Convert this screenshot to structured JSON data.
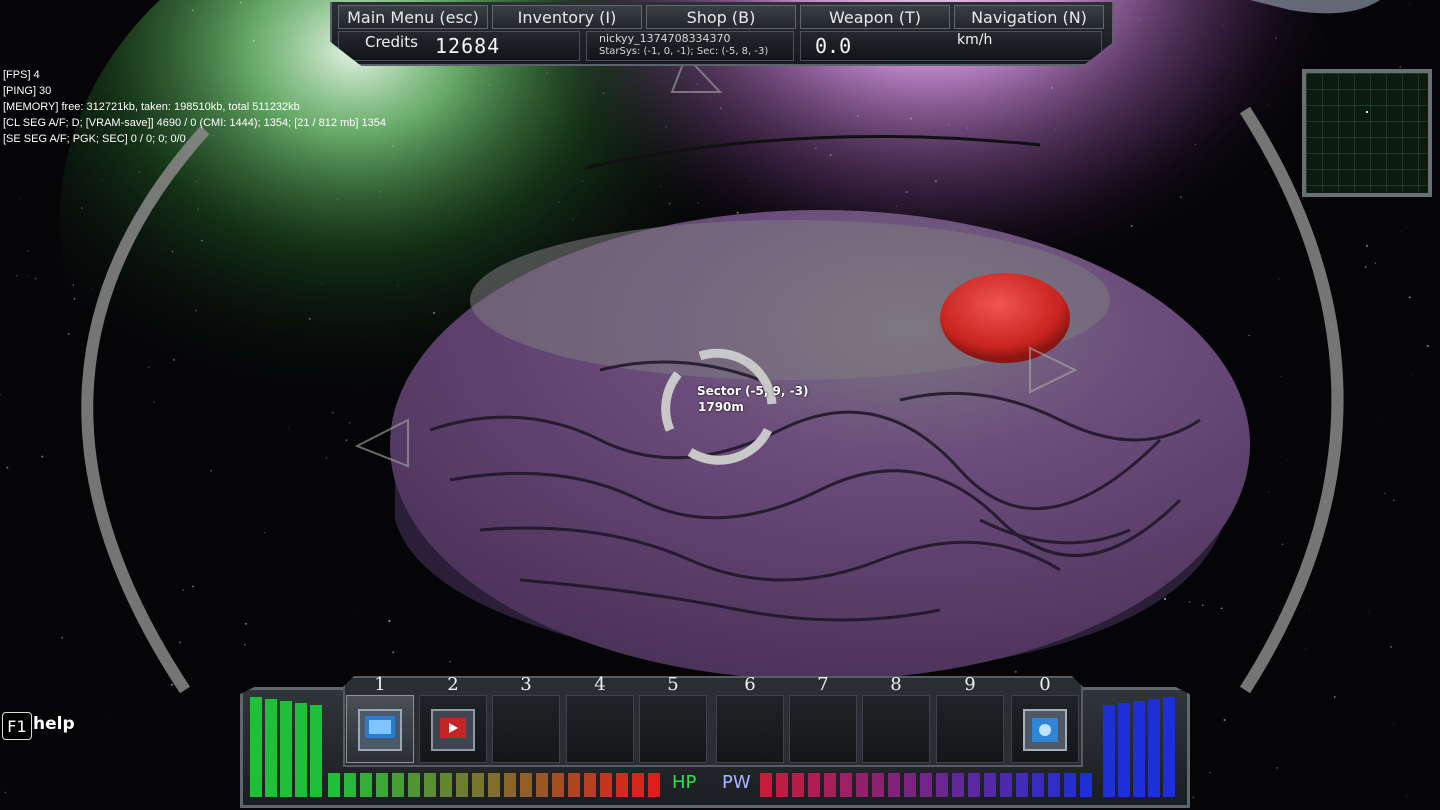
{
  "menu": {
    "items": [
      {
        "label": "Main Menu (esc)"
      },
      {
        "label": "Inventory (I)"
      },
      {
        "label": "Shop (B)"
      },
      {
        "label": "Weapon (T)"
      },
      {
        "label": "Navigation (N)"
      }
    ]
  },
  "status": {
    "credits_label": "Credits",
    "credits_value": "12684",
    "player_name": "nickyy_1374708334370",
    "location": "StarSys: (-1, 0, -1); Sec: (-5, 8, -3)",
    "speed_value": "0.0",
    "speed_unit": "km/h"
  },
  "debug": {
    "lines": [
      "[FPS] 4",
      "[PING] 30",
      "[MEMORY] free: 312721kb, taken: 198510kb, total 511232kb",
      "[CL SEG A/F; D; [VRAM-save]] 4690 / 0 (CMI: 1444); 1354; [21 / 812 mb] 1354",
      "[SE SEG A/F; PGK; SEC] 0 / 0; 0; 0/0"
    ]
  },
  "target": {
    "name": "Sector (-5, 9, -3)",
    "distance": "1790m"
  },
  "help": {
    "key": "F1",
    "label": "help"
  },
  "hotbar": {
    "slots": [
      {
        "number": "1",
        "item_icon": "ship-core-block-icon",
        "active": true
      },
      {
        "number": "2",
        "item_icon": "cannon-block-icon",
        "active": false
      },
      {
        "number": "3",
        "item_icon": "",
        "active": false
      },
      {
        "number": "4",
        "item_icon": "",
        "active": false
      },
      {
        "number": "5",
        "item_icon": "",
        "active": false
      },
      {
        "number": "6",
        "item_icon": "",
        "active": false
      },
      {
        "number": "7",
        "item_icon": "",
        "active": false
      },
      {
        "number": "8",
        "item_icon": "",
        "active": false
      },
      {
        "number": "9",
        "item_icon": "",
        "active": false
      },
      {
        "number": "0",
        "item_icon": "power-block-icon",
        "active": false
      }
    ]
  },
  "vitals": {
    "hp_label": "HP",
    "pw_label": "PW",
    "hp_fraction": 1.0,
    "pw_fraction": 1.0,
    "hp_color": "#1fbf3a",
    "pw_color": "#1f2fd8"
  },
  "colors": {
    "planet_purple": "#6a4d7a",
    "moon_red": "#d9322e",
    "hud_gray": "#5f666e"
  }
}
